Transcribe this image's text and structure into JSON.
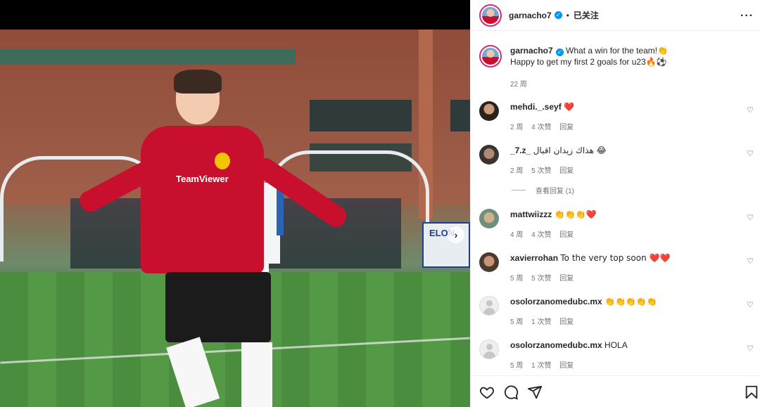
{
  "post": {
    "username": "garnacho7",
    "verified_mark": "✓",
    "separator": "•",
    "follow_state": "已关注",
    "more_icon": "more-horizontal-icon",
    "caption_line1": "What a win for the team!👏",
    "caption_line2": "Happy to get my first 2 goals for u23🔥⚽",
    "caption_time": "22 周"
  },
  "media": {
    "next_icon": "chevron-right-icon",
    "next_symbol": "›",
    "shirt_sponsor": "TeamViewer",
    "banner_text": "ELON"
  },
  "comments": [
    {
      "username": "mehdi._.seyf",
      "text": "❤️",
      "time": "2 周",
      "likes": "4 次赞",
      "reply": "回复"
    },
    {
      "username": "_7.z_",
      "text": "هذاك زيدان اقبال 😂",
      "time": "2 周",
      "likes": "5 次赞",
      "reply": "回复",
      "view_replies": "查看回复 (1)"
    },
    {
      "username": "mattwiizzz",
      "text": "👏👏👏❤️",
      "time": "4 周",
      "likes": "4 次赞",
      "reply": "回复"
    },
    {
      "username": "xavierrohan",
      "text": "To the very top soon ❤️❤️",
      "time": "5 周",
      "likes": "5 次赞",
      "reply": "回复"
    },
    {
      "username": "osolorzanomedubc.mx",
      "text": "👏👏👏👏👏",
      "time": "5 周",
      "likes": "1 次赞",
      "reply": "回复"
    },
    {
      "username": "osolorzanomedubc.mx",
      "text": "HOLA",
      "time": "5 周",
      "likes": "1 次赞",
      "reply": "回复"
    }
  ],
  "actions": {
    "like_icon": "heart-icon",
    "comment_icon": "comment-icon",
    "share_icon": "send-icon",
    "save_icon": "bookmark-icon"
  },
  "colors": {
    "verified": "#0095f6",
    "heart_red": "#ed4956",
    "meta_gray": "#737373",
    "shirt_red": "#c8102e"
  }
}
